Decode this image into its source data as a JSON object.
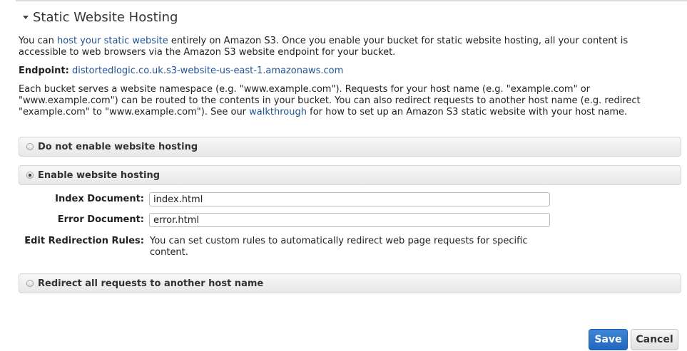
{
  "section": {
    "title": "Static Website Hosting"
  },
  "intro": {
    "prefix": "You can ",
    "link": "host your static website",
    "suffix": " entirely on Amazon S3. Once you enable your bucket for static website hosting, all your content is accessible to web browsers via the Amazon S3 website endpoint for your bucket."
  },
  "endpoint": {
    "label": "Endpoint:",
    "value": "distortedlogic.co.uk.s3-website-us-east-1.amazonaws.com"
  },
  "namespace": {
    "prefix": "Each bucket serves a website namespace (e.g. \"www.example.com\"). Requests for your host name (e.g. \"example.com\" or \"www.example.com\") can be routed to the contents in your bucket. You can also redirect requests to another host name (e.g. redirect \"example.com\" to \"www.example.com\"). See our ",
    "link": "walkthrough",
    "suffix": " for how to set up an Amazon S3 static website with your host name."
  },
  "options": {
    "disable": "Do not enable website hosting",
    "enable": "Enable website hosting",
    "redirect": "Redirect all requests to another host name",
    "selected": "enable"
  },
  "form": {
    "index_label": "Index Document:",
    "index_value": "index.html",
    "error_label": "Error Document:",
    "error_value": "error.html",
    "redirection_label": "Edit Redirection Rules:",
    "redirection_text": "You can set custom rules to automatically redirect web page requests for specific content."
  },
  "buttons": {
    "save": "Save",
    "cancel": "Cancel"
  },
  "colors": {
    "link": "#1e5494",
    "primary_button": "#2266c0"
  }
}
